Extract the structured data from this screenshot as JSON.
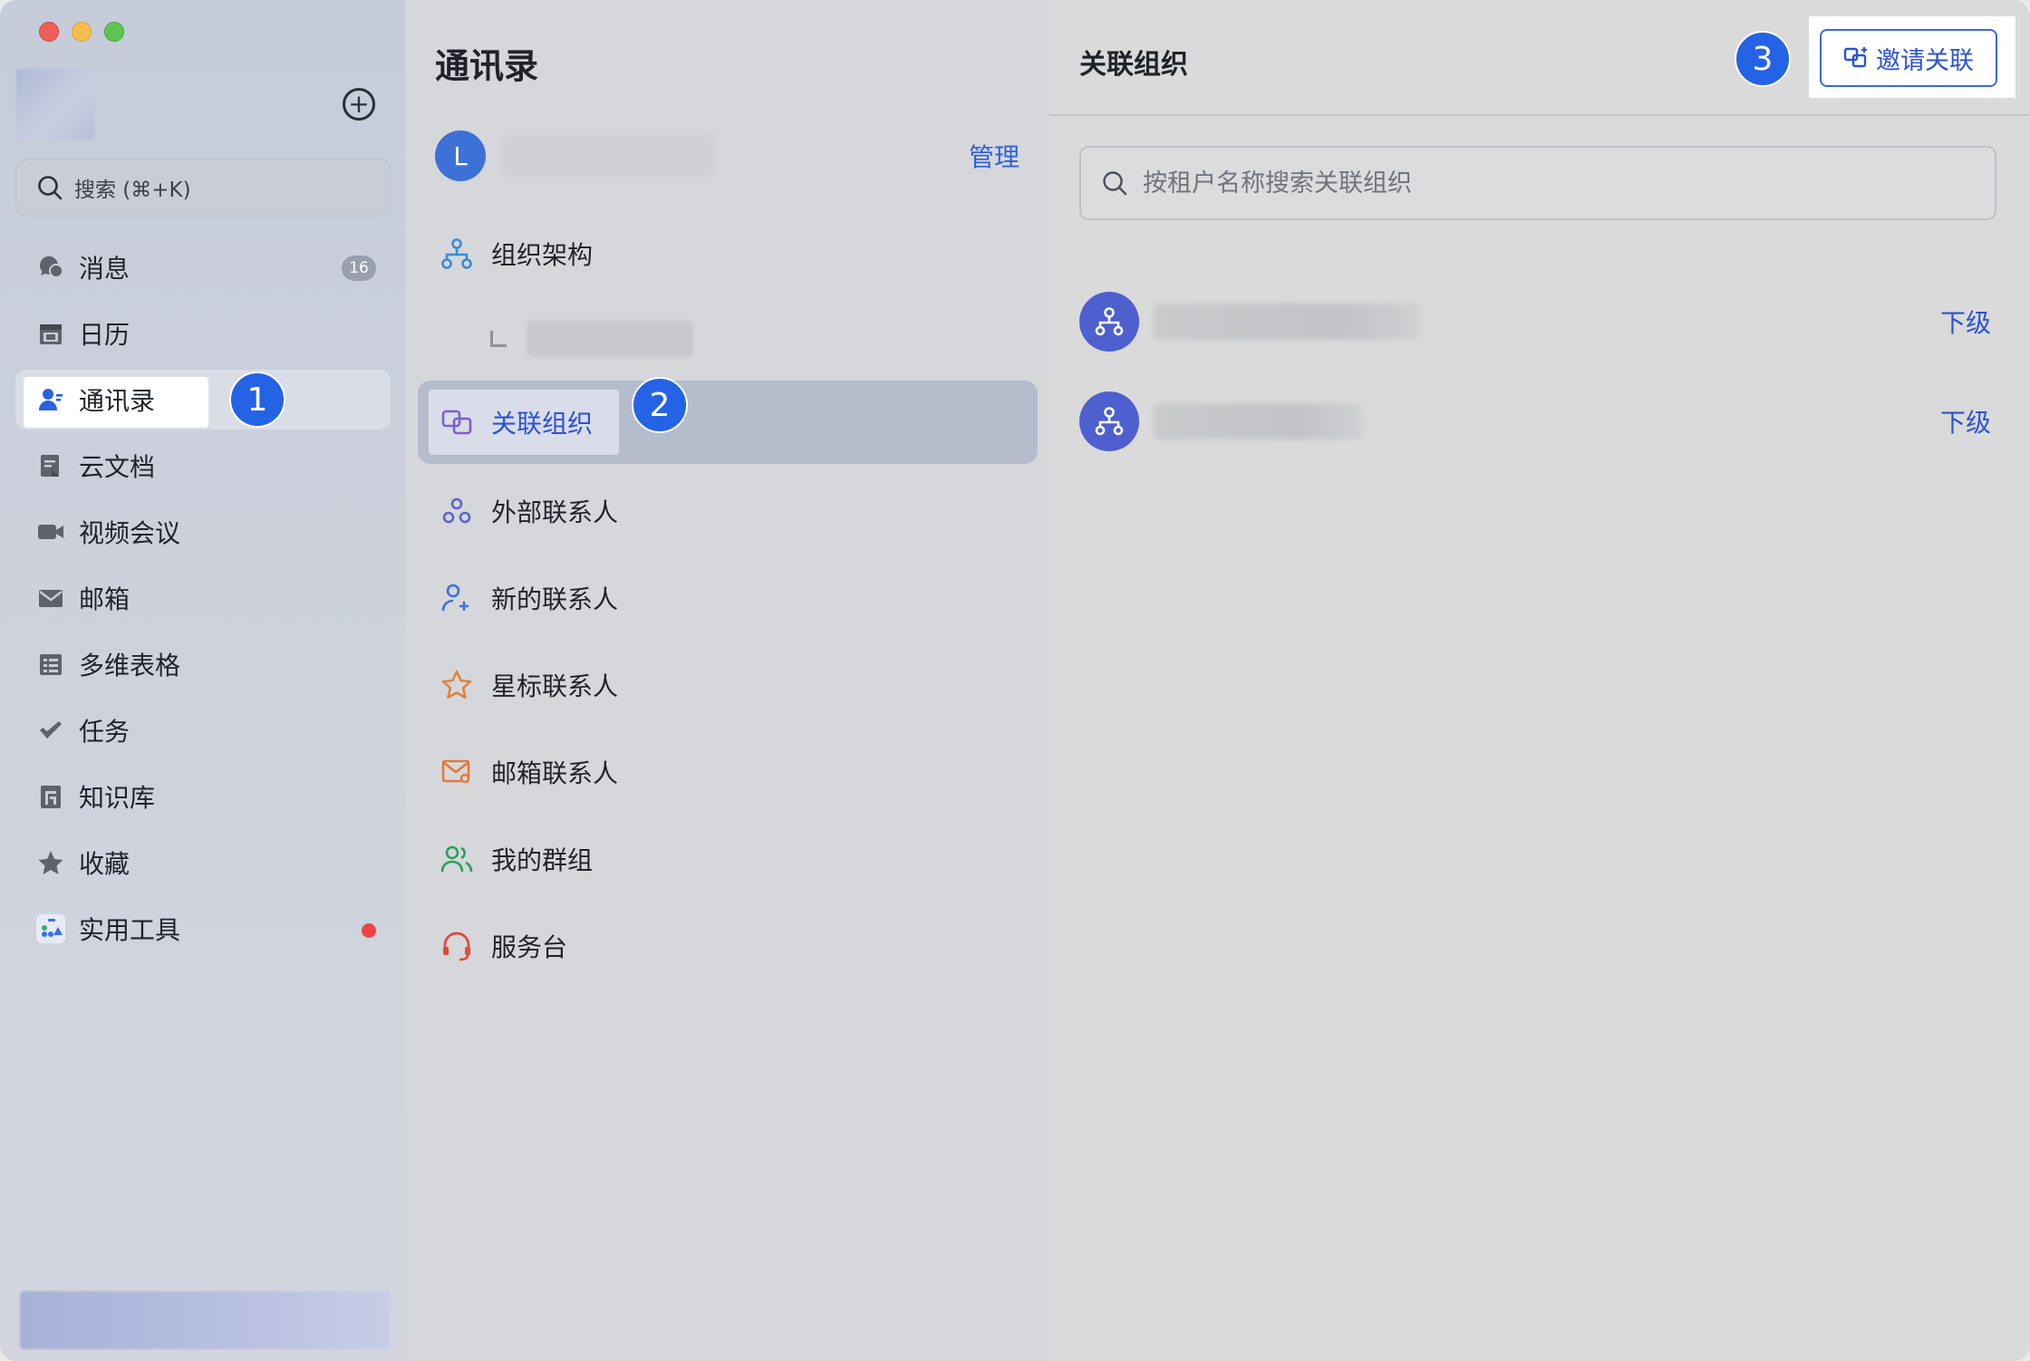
{
  "sidebar": {
    "search_placeholder": "搜索 (⌘+K)",
    "items": [
      {
        "label": "消息",
        "badge": "16"
      },
      {
        "label": "日历"
      },
      {
        "label": "通讯录"
      },
      {
        "label": "云文档"
      },
      {
        "label": "视频会议"
      },
      {
        "label": "邮箱"
      },
      {
        "label": "多维表格"
      },
      {
        "label": "任务"
      },
      {
        "label": "知识库"
      },
      {
        "label": "收藏"
      },
      {
        "label": "实用工具"
      }
    ],
    "active_item": "通讯录"
  },
  "steps": {
    "one": "1",
    "two": "2",
    "three": "3"
  },
  "contacts": {
    "title": "通讯录",
    "tenant_initial": "L",
    "manage_label": "管理",
    "items": [
      {
        "label": "组织架构"
      },
      {
        "label": "关联组织"
      },
      {
        "label": "外部联系人"
      },
      {
        "label": "新的联系人"
      },
      {
        "label": "星标联系人"
      },
      {
        "label": "邮箱联系人"
      },
      {
        "label": "我的群组"
      },
      {
        "label": "服务台"
      }
    ],
    "active_item": "关联组织"
  },
  "panel": {
    "title": "关联组织",
    "invite_label": "邀请关联",
    "search_placeholder": "按租户名称搜索关联组织",
    "orgs": [
      {
        "tag": "下级"
      },
      {
        "tag": "下级"
      }
    ]
  },
  "colors": {
    "accent": "#2c52d6",
    "step_badge": "#2463e6",
    "org_avatar": "#4e5fd0"
  }
}
